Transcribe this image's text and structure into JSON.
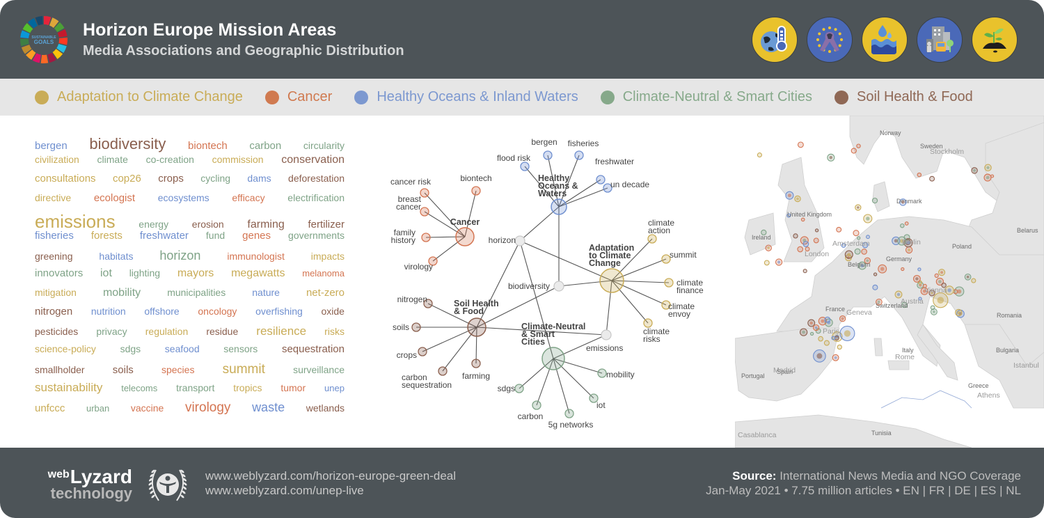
{
  "header": {
    "title": "Horizon Europe Mission Areas",
    "subtitle": "Media Associations and Geographic Distribution",
    "sdg_logo_text": "GOALS",
    "mission_icons": [
      {
        "name": "climate-thermometer-icon",
        "bg": "#e9c22c"
      },
      {
        "name": "eu-cancer-ribbon-icon",
        "bg": "#4a69b8"
      },
      {
        "name": "water-drop-icon",
        "bg": "#e9c22c"
      },
      {
        "name": "smart-city-tram-icon",
        "bg": "#4a69b8"
      },
      {
        "name": "soil-sprout-icon",
        "bg": "#e9c22c"
      }
    ]
  },
  "legend": [
    {
      "label": "Adaptation to Climate Change",
      "color": "#c9ac57"
    },
    {
      "label": "Cancer",
      "color": "#d07a50"
    },
    {
      "label": "Healthy Oceans & Inland Waters",
      "color": "#7c98d0"
    },
    {
      "label": "Climate-Neutral & Smart Cities",
      "color": "#86a98a"
    },
    {
      "label": "Soil Health & Food",
      "color": "#8f6855"
    }
  ],
  "colors": {
    "adaptation": "#c9ac57",
    "cancer": "#d47552",
    "oceans": "#6f8fcf",
    "cities": "#7fa387",
    "soil": "#8a5f4e",
    "shared": "#cfcfcf"
  },
  "word_cloud": [
    [
      [
        "bergen",
        "oceans",
        15
      ],
      [
        "biodiversity",
        "soil",
        22
      ],
      [
        "biontech",
        "cancer",
        15
      ],
      [
        "carbon",
        "cities",
        15
      ],
      [
        "circularity",
        "cities",
        14
      ]
    ],
    [
      [
        "civilization",
        "adaptation",
        14
      ],
      [
        "climate",
        "cities",
        14
      ],
      [
        "co-creation",
        "cities",
        14
      ],
      [
        "commission",
        "adaptation",
        14
      ],
      [
        "conservation",
        "soil",
        16
      ]
    ],
    [
      [
        "consultations",
        "adaptation",
        15
      ],
      [
        "cop26",
        "adaptation",
        15
      ],
      [
        "crops",
        "soil",
        15
      ],
      [
        "cycling",
        "cities",
        14
      ],
      [
        "dams",
        "oceans",
        14
      ],
      [
        "deforestation",
        "soil",
        14
      ]
    ],
    [
      [
        "directive",
        "adaptation",
        14
      ],
      [
        "ecologist",
        "cancer",
        15
      ],
      [
        "ecosystems",
        "oceans",
        14
      ],
      [
        "efficacy",
        "cancer",
        14
      ],
      [
        "electrification",
        "cities",
        14
      ]
    ],
    [
      [
        "emissions",
        "adaptation",
        26
      ],
      [
        "energy",
        "cities",
        14
      ],
      [
        "erosion",
        "soil",
        14
      ],
      [
        "farming",
        "soil",
        16
      ],
      [
        "fertilizer",
        "soil",
        15
      ]
    ],
    [
      [
        "fisheries",
        "oceans",
        15
      ],
      [
        "forests",
        "adaptation",
        15
      ],
      [
        "freshwater",
        "oceans",
        15
      ],
      [
        "fund",
        "cities",
        14
      ],
      [
        "genes",
        "cancer",
        15
      ],
      [
        "governments",
        "cities",
        14
      ]
    ],
    [
      [
        "greening",
        "soil",
        14
      ],
      [
        "habitats",
        "oceans",
        14
      ],
      [
        "horizon",
        "cities",
        18
      ],
      [
        "immunologist",
        "cancer",
        14
      ],
      [
        "impacts",
        "adaptation",
        14
      ]
    ],
    [
      [
        "innovators",
        "cities",
        15
      ],
      [
        "iot",
        "cities",
        16
      ],
      [
        "lighting",
        "cities",
        14
      ],
      [
        "mayors",
        "adaptation",
        16
      ],
      [
        "megawatts",
        "adaptation",
        16
      ],
      [
        "melanoma",
        "cancer",
        13
      ]
    ],
    [
      [
        "mitigation",
        "adaptation",
        14
      ],
      [
        "mobility",
        "cities",
        16
      ],
      [
        "municipalities",
        "cities",
        14
      ],
      [
        "nature",
        "oceans",
        14
      ],
      [
        "net-zero",
        "adaptation",
        15
      ]
    ],
    [
      [
        "nitrogen",
        "soil",
        15
      ],
      [
        "nutrition",
        "oceans",
        14
      ],
      [
        "offshore",
        "oceans",
        14
      ],
      [
        "oncology",
        "cancer",
        14
      ],
      [
        "overfishing",
        "oceans",
        14
      ],
      [
        "oxide",
        "soil",
        14
      ]
    ],
    [
      [
        "pesticides",
        "soil",
        14
      ],
      [
        "privacy",
        "cities",
        14
      ],
      [
        "regulation",
        "adaptation",
        14
      ],
      [
        "residue",
        "soil",
        14
      ],
      [
        "resilience",
        "adaptation",
        17
      ],
      [
        "risks",
        "adaptation",
        14
      ]
    ],
    [
      [
        "science-policy",
        "adaptation",
        14
      ],
      [
        "sdgs",
        "cities",
        14
      ],
      [
        "seafood",
        "oceans",
        14
      ],
      [
        "sensors",
        "cities",
        14
      ],
      [
        "sequestration",
        "soil",
        15
      ]
    ],
    [
      [
        "smallholder",
        "soil",
        14
      ],
      [
        "soils",
        "soil",
        15
      ],
      [
        "species",
        "cancer",
        14
      ],
      [
        "summit",
        "adaptation",
        19
      ],
      [
        "surveillance",
        "cities",
        14
      ]
    ],
    [
      [
        "sustainability",
        "adaptation",
        17
      ],
      [
        "telecoms",
        "cities",
        13
      ],
      [
        "transport",
        "cities",
        14
      ],
      [
        "tropics",
        "adaptation",
        14
      ],
      [
        "tumor",
        "cancer",
        14
      ],
      [
        "unep",
        "oceans",
        13
      ]
    ],
    [
      [
        "unfccc",
        "adaptation",
        15
      ],
      [
        "urban",
        "cities",
        13
      ],
      [
        "vaccine",
        "cancer",
        14
      ],
      [
        "virology",
        "cancer",
        19
      ],
      [
        "waste",
        "oceans",
        18
      ],
      [
        "wetlands",
        "soil",
        14
      ]
    ]
  ],
  "network": {
    "hubs": [
      {
        "id": "cancer",
        "label": [
          "Cancer"
        ],
        "group": "cancer"
      },
      {
        "id": "oceans",
        "label": [
          "Healthy",
          "Oceans &",
          "Waters"
        ],
        "group": "oceans"
      },
      {
        "id": "adaptation",
        "label": [
          "Adaptation",
          "to Climate",
          "Change"
        ],
        "group": "adaptation"
      },
      {
        "id": "soil",
        "label": [
          "Soil Health",
          "& Food"
        ],
        "group": "soil"
      },
      {
        "id": "cities",
        "label": [
          "Climate-Neutral",
          "& Smart",
          "Cities"
        ],
        "group": "cities"
      }
    ],
    "shared": [
      {
        "id": "horizon",
        "label": [
          "horizon"
        ]
      },
      {
        "id": "biodiversity",
        "label": [
          "biodiversity"
        ]
      },
      {
        "id": "emissions",
        "label": [
          "emissions"
        ]
      }
    ],
    "leaves": [
      {
        "hub": "cancer",
        "label": [
          "cancer risk"
        ]
      },
      {
        "hub": "cancer",
        "label": [
          "biontech"
        ]
      },
      {
        "hub": "cancer",
        "label": [
          "breast",
          "cancer"
        ]
      },
      {
        "hub": "cancer",
        "label": [
          "family",
          "history"
        ]
      },
      {
        "hub": "cancer",
        "label": [
          "virology"
        ]
      },
      {
        "hub": "oceans",
        "label": [
          "bergen"
        ]
      },
      {
        "hub": "oceans",
        "label": [
          "fisheries"
        ]
      },
      {
        "hub": "oceans",
        "label": [
          "flood risk"
        ]
      },
      {
        "hub": "oceans",
        "label": [
          "freshwater"
        ]
      },
      {
        "hub": "oceans",
        "label": [
          "un decade"
        ]
      },
      {
        "hub": "adaptation",
        "label": [
          "climate",
          "action"
        ]
      },
      {
        "hub": "adaptation",
        "label": [
          "summit"
        ]
      },
      {
        "hub": "adaptation",
        "label": [
          "climate",
          "finance"
        ]
      },
      {
        "hub": "adaptation",
        "label": [
          "climate",
          "envoy"
        ]
      },
      {
        "hub": "adaptation",
        "label": [
          "climate",
          "risks"
        ]
      },
      {
        "hub": "soil",
        "label": [
          "nitrogen"
        ]
      },
      {
        "hub": "soil",
        "label": [
          "soils"
        ]
      },
      {
        "hub": "soil",
        "label": [
          "crops"
        ]
      },
      {
        "hub": "soil",
        "label": [
          "carbon",
          "sequestration"
        ]
      },
      {
        "hub": "soil",
        "label": [
          "farming"
        ]
      },
      {
        "hub": "cities",
        "label": [
          "mobility"
        ]
      },
      {
        "hub": "cities",
        "label": [
          "iot"
        ]
      },
      {
        "hub": "cities",
        "label": [
          "5g networks"
        ]
      },
      {
        "hub": "cities",
        "label": [
          "carbon"
        ]
      },
      {
        "hub": "cities",
        "label": [
          "sdgs"
        ]
      }
    ],
    "links": [
      [
        "horizon",
        "oceans"
      ],
      [
        "horizon",
        "adaptation"
      ],
      [
        "horizon",
        "soil"
      ],
      [
        "horizon",
        "cities"
      ],
      [
        "biodiversity",
        "oceans"
      ],
      [
        "biodiversity",
        "adaptation"
      ],
      [
        "biodiversity",
        "soil"
      ],
      [
        "emissions",
        "adaptation"
      ],
      [
        "emissions",
        "soil"
      ],
      [
        "emissions",
        "cities"
      ]
    ]
  },
  "map": {
    "labels": {
      "countries": [
        "Norway",
        "Sweden",
        "United Kingdom",
        "Ireland",
        "Denmark",
        "Belarus",
        "Poland",
        "Germany",
        "Belgium",
        "France",
        "Switzerland",
        "Romania",
        "Bulgaria",
        "Italy",
        "Portugal",
        "Spain",
        "Greece",
        "Tunisia"
      ],
      "cities": [
        "Stockholm",
        "Amsterdam",
        "London",
        "Berlin",
        "Paris",
        "Vienna",
        "Austria",
        "Geneva",
        "Rome",
        "Madrid",
        "Istanbul",
        "Athens",
        "Casablanca"
      ]
    }
  },
  "footer": {
    "brand_web": "web",
    "brand_lyzard": "Lyzard",
    "brand_tech": "technology",
    "urls": [
      "www.weblyzard.com/horizon-europe-green-deal",
      "www.weblyzard.com/unep-live"
    ],
    "source_label": "Source:",
    "source_text": "International News Media and NGO Coverage",
    "source_details": "Jan-May 2021 • 7.75 million articles • EN | FR | DE | ES | NL"
  }
}
